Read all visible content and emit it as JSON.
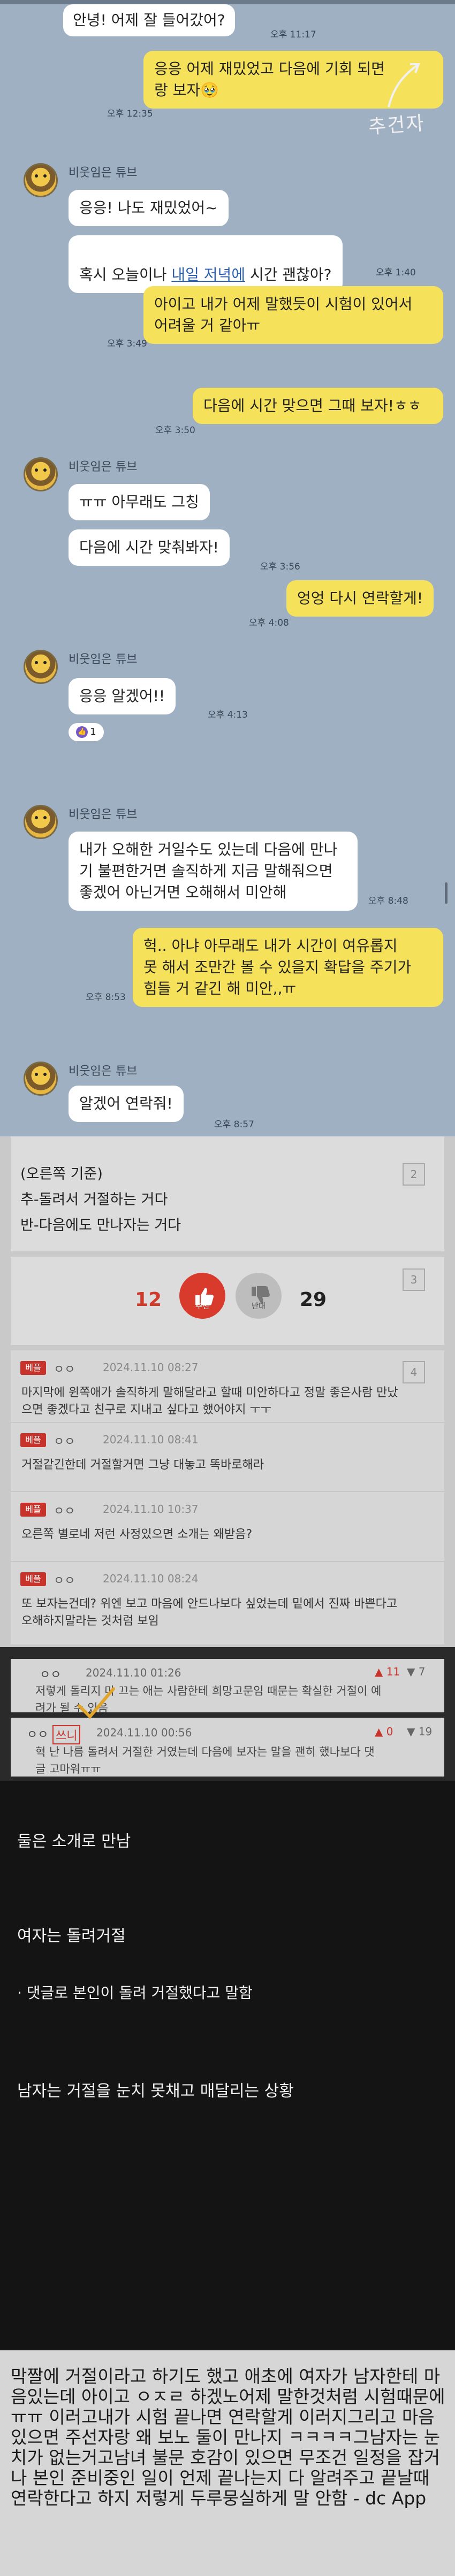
{
  "chat": {
    "sender_name": "비웃임은 튜브",
    "handwritten_note": "추건자",
    "messages": [
      {
        "side": "left",
        "text": "안녕! 어제 잘 들어갔어?",
        "time": "오후 11:17"
      },
      {
        "side": "right",
        "text": "응응 어제 재밌었고 다음에 기회 되면\n랑 보자🥹",
        "time": "오후 12:35"
      },
      {
        "side": "left",
        "text": "응응! 나도 재밌었어~",
        "time": ""
      },
      {
        "side": "left",
        "text_before": "혹시 오늘이나 ",
        "link": "내일 저녁에",
        "text_after": " 시간 괜찮아?",
        "time": "오후 1:40"
      },
      {
        "side": "right",
        "text": "아이고 내가 어제 말했듯이 시험이 있어서\n어려울 거 같아ㅠ",
        "time": "오후 3:49"
      },
      {
        "side": "right",
        "text": "다음에 시간 맞으면 그때 보자!ㅎㅎ",
        "time": "오후 3:50"
      },
      {
        "side": "left",
        "text": "ㅠㅠ 아무래도 그칭",
        "time": ""
      },
      {
        "side": "left",
        "text": "다음에 시간 맞춰봐자!",
        "time": "오후 3:56"
      },
      {
        "side": "right",
        "text": "엉엉 다시 연락할게!",
        "time": "오후 4:08"
      },
      {
        "side": "left",
        "text": "응응 알겠어!!",
        "time": "오후 4:13"
      },
      {
        "side": "left",
        "text": "내가 오해한 거일수도 있는데 다음에 만나\n기 불편한거면 솔직하게 지금 말해줘으면\n좋겠어 아닌거면 오해해서 미안해",
        "time": "오후 8:48"
      },
      {
        "side": "right",
        "text": "헉.. 아냐 아무래도 내가 시간이 여유롭지\n못 해서 조만간 볼 수 있을지 확답을 주기가\n힘들 거 같긴 해 미안,,ㅠ",
        "time": "오후 8:53"
      },
      {
        "side": "left",
        "text": "알겠어 연락줘!",
        "time": "오후 8:57"
      }
    ],
    "reaction": {
      "icon": "thumbs-up-icon",
      "count": "1"
    }
  },
  "post": {
    "lines": [
      "(오른쪽 기준)",
      "추-돌려서 거절하는 거다",
      "반-다음에도 만나자는 거다"
    ],
    "page_markers": [
      "2",
      "3",
      "4"
    ],
    "upvotes": "12",
    "upvote_label": "추천",
    "downvotes": "29",
    "downvote_label": "반대",
    "comments": [
      {
        "badge": "베플",
        "nick": "ㅇㅇ",
        "time": "2024.11.10 08:27",
        "body": "마지막에 윈쪽애가 솔직하게 말해달라고 할때 미안하다고 정말 좋은사람 만났\n으면 좋겠다고 친구로 지내고 싶다고 했어야지 ㅜㅜ"
      },
      {
        "badge": "베플",
        "nick": "ㅇㅇ",
        "time": "2024.11.10 08:41",
        "body": "거절같긴한데 거절할거면 그냥 대놓고 똑바로해라"
      },
      {
        "badge": "베플",
        "nick": "ㅇㅇ",
        "time": "2024.11.10 10:37",
        "body": "오른쪽 별로네 저런 사정있으면 소개는 왜받음?"
      },
      {
        "badge": "베플",
        "nick": "ㅇㅇ",
        "time": "2024.11.10 08:24",
        "body": "또 보자는건데? 위엔 보고 마음에 안드나보다 싶었는데 밑에서 진짜 바쁜다고\n오해하지말라는 것처럼 보임"
      }
    ],
    "dark_comments": [
      {
        "nick": "ㅇㅇ",
        "time": "2024.11.10 01:26",
        "up": "11",
        "down": "7",
        "body": "저렇게 돌리지 마 끄는 애는 사람한테 희망고문임 때문는 확실한 거절이 예\n려가 될 수 있음"
      },
      {
        "nick": "ㅇㅇ",
        "highlight": "쓰니",
        "time": "2024.11.10 00:56",
        "up": "0",
        "down": "19",
        "body": "혁 난 나름 돌려서 거절한 거였는데 다음에 보자는 말을 괜히 했나보다 댓\n글 고마워ㅠㅠ"
      }
    ]
  },
  "summary": {
    "lines": [
      "둘은 소개로 만남",
      "여자는 돌려거절",
      "· 댓글로 본인이 돌려 거절했다고 말함",
      "남자는 거절을 눈치 못채고 매달리는 상황"
    ],
    "dc_text": "막짤에 거절이라고 하기도 했고 애초에 여자가 남자한테 마음있는데 아이고 ㅇㅈㄹ 하겠노어제 말한것처럼 시험때문에 ㅠㅠ 이러고내가 시험 끝나면 연락할게 이러지그리고 마음있으면 주선자랑 왜 보노 둘이 만나지 ㅋㅋㅋㅋ그남자는 눈치가 없는거고남녀 불문 호감이 있으면 무조건 일정을 잡거나 본인 준비중인 일이 언제 끝나는지 다 알려주고 끝날때 연락한다고 하지 저렇게 두루뭉실하게 말 안함 - dc App"
  }
}
